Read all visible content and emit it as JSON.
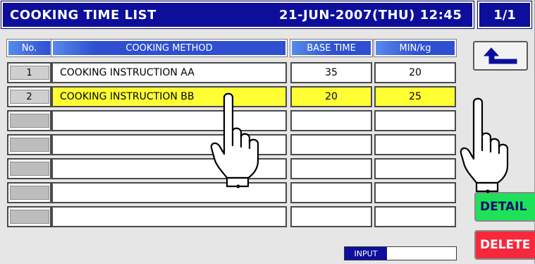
{
  "title": "COOKING TIME LIST",
  "datetime": "21-JUN-2007(THU) 12:45",
  "page": "1/1",
  "headers": {
    "no": "No.",
    "method": "COOKING METHOD",
    "base_time": "BASE TIME",
    "min_per_kg": "MIN/kg"
  },
  "rows": [
    {
      "no": "1",
      "method": "COOKING INSTRUCTION AA",
      "base_time": "35",
      "min_per_kg": "20",
      "selected": false
    },
    {
      "no": "2",
      "method": "COOKING INSTRUCTION BB",
      "base_time": "20",
      "min_per_kg": "25",
      "selected": true
    },
    {
      "no": "",
      "method": "",
      "base_time": "",
      "min_per_kg": "",
      "selected": false
    },
    {
      "no": "",
      "method": "",
      "base_time": "",
      "min_per_kg": "",
      "selected": false
    },
    {
      "no": "",
      "method": "",
      "base_time": "",
      "min_per_kg": "",
      "selected": false
    },
    {
      "no": "",
      "method": "",
      "base_time": "",
      "min_per_kg": "",
      "selected": false
    },
    {
      "no": "",
      "method": "",
      "base_time": "",
      "min_per_kg": "",
      "selected": false
    }
  ],
  "buttons": {
    "back_icon": "back-arrow-icon",
    "detail": "DETAIL",
    "delete": "DELETE"
  },
  "input": {
    "label": "INPUT",
    "value": ""
  },
  "colors": {
    "title_bg": "#0d0f9c",
    "header_bg": "#2f4fd0",
    "selected_row": "#ffff33",
    "detail_button": "#1ee15a",
    "delete_button": "#f5283c"
  }
}
